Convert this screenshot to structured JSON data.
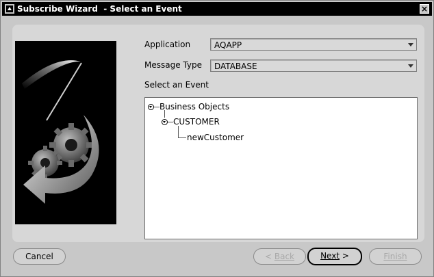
{
  "window": {
    "title": "Subscribe Wizard  - Select an Event",
    "close_label": "×"
  },
  "form": {
    "application_label": "Application",
    "application_value": "AQAPP",
    "message_type_label": "Message Type",
    "message_type_value": "DATABASE",
    "select_event_label": "Select an Event"
  },
  "tree": {
    "root": "Business Objects",
    "child": "CUSTOMER",
    "leaf": "newCustomer"
  },
  "buttons": {
    "cancel": "Cancel",
    "back": "Back",
    "next": "Next",
    "finish": "Finish",
    "back_arrow": "<",
    "next_arrow": ">"
  },
  "icons": {
    "title": "app-icon",
    "illustration": "gears-arrow-illustration",
    "tree_expand": "expanded-disclosure-icon"
  },
  "colors": {
    "titlebar": "#000000",
    "window_bg": "#c8c8c8",
    "panel_bg": "#d7d7d7",
    "tree_bg": "#ffffff"
  }
}
